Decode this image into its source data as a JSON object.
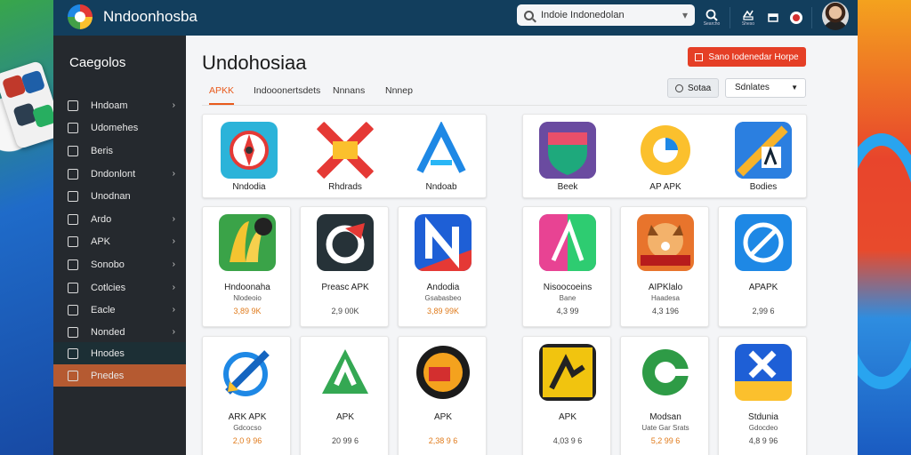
{
  "app": {
    "title": "Nndoonhosba"
  },
  "search": {
    "value": "Indoie Indonedolan"
  },
  "toolbar": {
    "search_caption": "Searcho",
    "share_caption": "Sheso",
    "window_caption": "",
    "record_caption": ""
  },
  "sidebar": {
    "title": "Caegolos",
    "items": [
      {
        "label": "Hndoam",
        "chevron": true
      },
      {
        "label": "Udomehes",
        "chevron": false
      },
      {
        "label": "Beris",
        "chevron": false
      },
      {
        "label": "Dndonlont",
        "chevron": true
      },
      {
        "label": "Unodnan",
        "chevron": false
      },
      {
        "label": "Ardo",
        "chevron": true
      },
      {
        "label": "APK",
        "chevron": true
      },
      {
        "label": "Sonobo",
        "chevron": true
      },
      {
        "label": "Cotlcies",
        "chevron": true
      },
      {
        "label": "Eacle",
        "chevron": true
      },
      {
        "label": "Nonded",
        "chevron": true
      },
      {
        "label": "Hnodes",
        "chevron": false
      },
      {
        "label": "Pnedes",
        "chevron": false
      }
    ]
  },
  "main": {
    "title": "Undohosiaa",
    "cta_label": "Sano Iodenedar Horpe",
    "tabs": [
      "APKK",
      "Indooonertsdets",
      "Nnnans",
      "Nnnep"
    ],
    "sort_label": "Sotaa",
    "filter_label": "Sdnlates"
  },
  "featured_left": [
    {
      "name": "Nndodia"
    },
    {
      "name": "Rhdrads"
    },
    {
      "name": "Nndoab"
    }
  ],
  "featured_right": [
    {
      "name": "Beek"
    },
    {
      "name": "AP APK"
    },
    {
      "name": "Bodies"
    }
  ],
  "apps_row1": [
    {
      "name": "Hndoonaha",
      "sub": "Nlodeoio",
      "meta": "3,89 9K"
    },
    {
      "name": "Preasc APK",
      "sub": "",
      "meta": "2,9 00K"
    },
    {
      "name": "Andodia",
      "sub": "Gsabasbeo",
      "meta": "3,89 99K"
    },
    {
      "name": "Nisoocoeins",
      "sub": "Bane",
      "meta": "4,3 99"
    },
    {
      "name": "AIPKlalo",
      "sub": "Haadesa",
      "meta": "4,3 196"
    },
    {
      "name": "APAPK",
      "sub": "",
      "meta": "2,99 6"
    }
  ],
  "apps_row2": [
    {
      "name": "ARK APK",
      "sub": "Gdcocso",
      "meta": "2,0 9 96"
    },
    {
      "name": "APK",
      "sub": "",
      "meta": "20 99 6"
    },
    {
      "name": "APK",
      "sub": "",
      "meta": "2,38 9 6"
    },
    {
      "name": "APK",
      "sub": "",
      "meta": "4,03 9 6"
    },
    {
      "name": "Modsan",
      "sub": "Uate Gar Srats",
      "meta": "5,2 99 6"
    },
    {
      "name": "Stdunia",
      "sub": "Gdocdeo",
      "meta": "4,8 9 96"
    }
  ],
  "icons": [
    "compass-app-icon",
    "sale-tag-app-icon",
    "lambda-app-icon",
    "shield-app-icon",
    "c-ring-app-icon",
    "pencil-app-icon",
    "banana-app-icon",
    "c-arrow-app-icon",
    "n-app-icon",
    "lambda-gradient-app-icon",
    "shiba-app-icon",
    "no-sign-app-icon",
    "rocket-app-icon",
    "a-triangle-app-icon",
    "dj-app-icon",
    "kicker-app-icon",
    "g-refresh-app-icon",
    "x-flag-app-icon"
  ],
  "colors": {
    "topbar": "#123e5d",
    "sidebar": "#25292e",
    "accent": "#e85a1c",
    "cta": "#e53f26"
  }
}
